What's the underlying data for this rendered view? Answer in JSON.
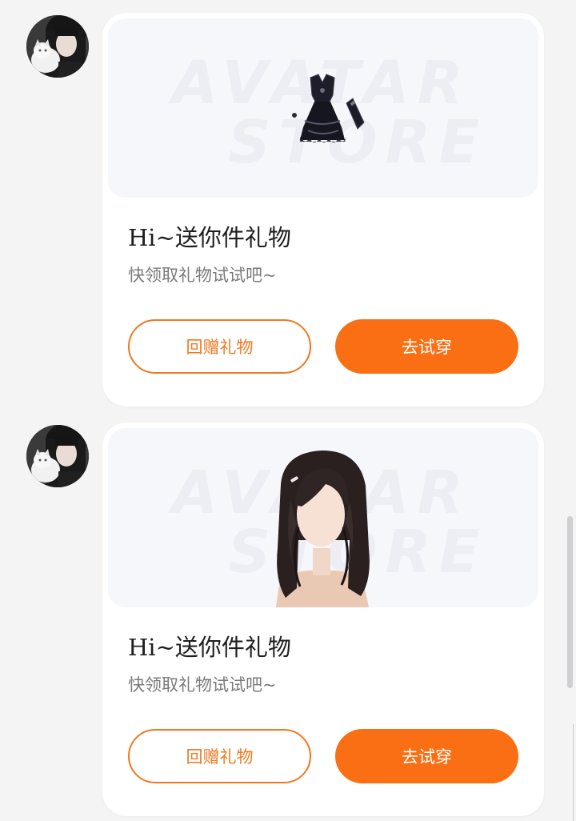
{
  "colors": {
    "accent": "#fb6f14",
    "accent_outline": "#f07920",
    "page_bg": "#f4f4f5",
    "card_bg": "#ffffff",
    "hero_bg": "#f6f7fb"
  },
  "messages": [
    {
      "avatar_icon": "user-avatar-with-cat",
      "watermark_line1": "AVATAR",
      "watermark_line2": "STORE",
      "gift_icon": "black-gothic-dress-item",
      "title": "Hi~送你件礼物",
      "subtitle": "快领取礼物试试吧~",
      "return_gift_label": "回赠礼物",
      "try_on_label": "去试穿"
    },
    {
      "avatar_icon": "user-avatar-with-cat",
      "watermark_line1": "AVATAR",
      "watermark_line2": "STORE",
      "gift_icon": "long-dark-hair-item",
      "title": "Hi~送你件礼物",
      "subtitle": "快领取礼物试试吧~",
      "return_gift_label": "回赠礼物",
      "try_on_label": "去试穿"
    }
  ]
}
